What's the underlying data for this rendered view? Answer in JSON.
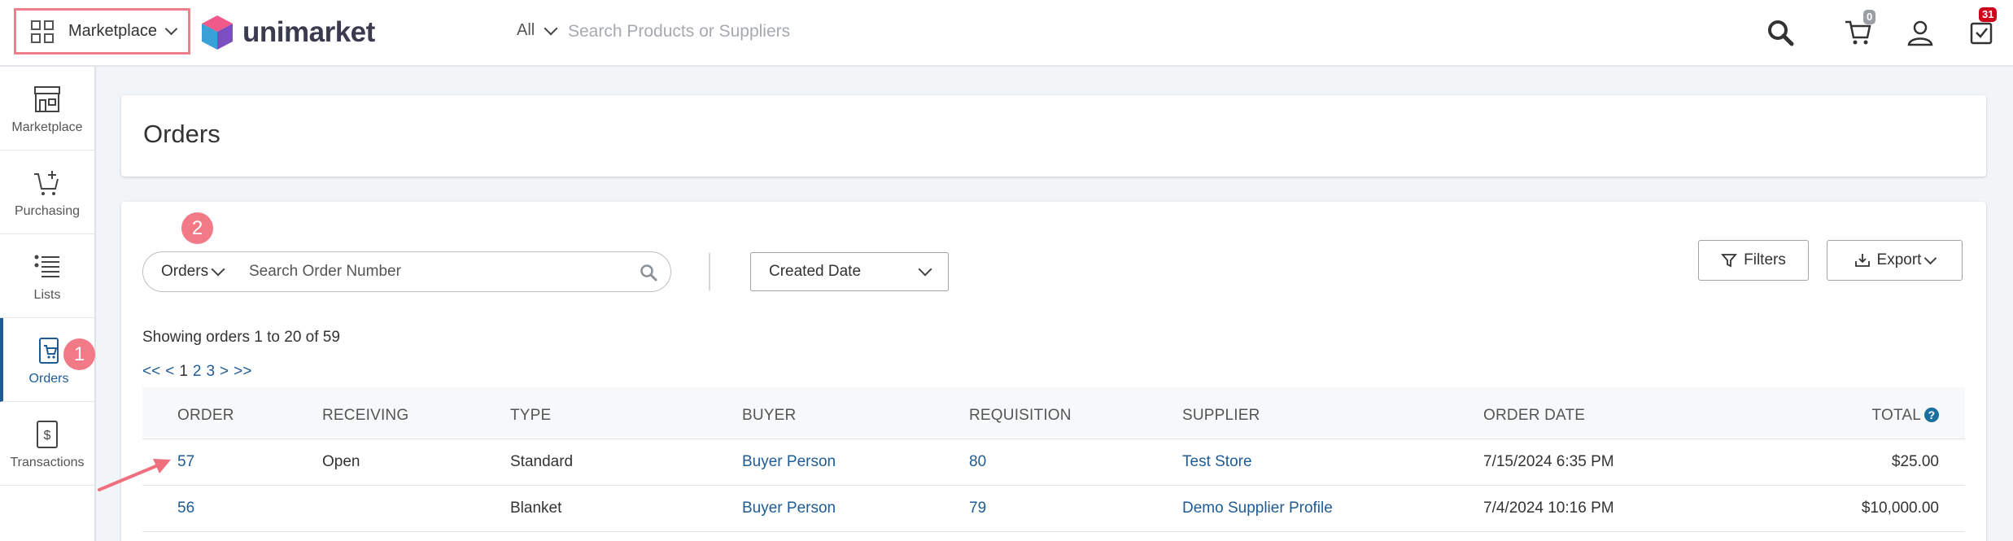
{
  "header": {
    "marketplace_label": "Marketplace",
    "logo_text": "unimarket",
    "search_scope": "All",
    "search_placeholder": "Search Products or Suppliers",
    "cart_count": "0",
    "tasks_count": "31"
  },
  "sidebar": {
    "items": [
      {
        "label": "Marketplace",
        "icon": "storefront-icon"
      },
      {
        "label": "Purchasing",
        "icon": "cart-plus-icon"
      },
      {
        "label": "Lists",
        "icon": "list-icon"
      },
      {
        "label": "Orders",
        "icon": "order-cart-icon"
      },
      {
        "label": "Transactions",
        "icon": "receipt-dollar-icon"
      }
    ],
    "active": "Orders"
  },
  "annotations": {
    "step1": "1",
    "step2": "2"
  },
  "page": {
    "title": "Orders"
  },
  "filters": {
    "search_type": "Orders",
    "search_placeholder": "Search Order Number",
    "date_select": "Created Date",
    "filters_label": "Filters",
    "export_label": "Export"
  },
  "results": {
    "showing": "Showing orders 1 to 20 of 59",
    "pager": {
      "first": "<<",
      "prev": "<",
      "pages": [
        "1",
        "2",
        "3"
      ],
      "next": ">",
      "last": ">>"
    }
  },
  "table": {
    "headers": [
      "ORDER",
      "RECEIVING",
      "TYPE",
      "BUYER",
      "REQUISITION",
      "SUPPLIER",
      "ORDER DATE",
      "TOTAL"
    ],
    "rows": [
      {
        "order": "57",
        "receiving": "Open",
        "type": "Standard",
        "buyer": "Buyer Person",
        "requisition": "80",
        "supplier": "Test Store",
        "order_date": "7/15/2024 6:35 PM",
        "total": "$25.00"
      },
      {
        "order": "56",
        "receiving": "",
        "type": "Blanket",
        "buyer": "Buyer Person",
        "requisition": "79",
        "supplier": "Demo Supplier Profile",
        "order_date": "7/4/2024 10:16 PM",
        "total": "$10,000.00"
      }
    ]
  },
  "colors": {
    "link": "#1f5b94",
    "annotation": "#f27a87",
    "badge_red": "#d0021b"
  }
}
